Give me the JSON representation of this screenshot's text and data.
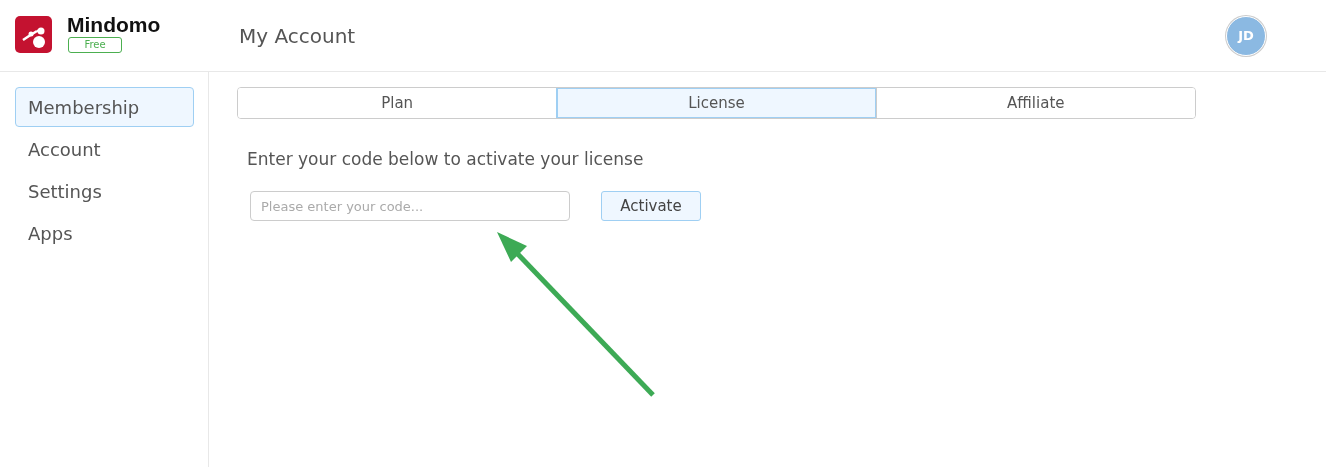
{
  "app": {
    "name": "Mindomo",
    "plan_badge": "Free"
  },
  "header": {
    "title": "My Account",
    "avatar_initials": "JD"
  },
  "sidebar": {
    "items": [
      {
        "label": "Membership",
        "selected": true
      },
      {
        "label": "Account",
        "selected": false
      },
      {
        "label": "Settings",
        "selected": false
      },
      {
        "label": "Apps",
        "selected": false
      }
    ]
  },
  "tabs": [
    {
      "label": "Plan",
      "selected": false
    },
    {
      "label": "License",
      "selected": true
    },
    {
      "label": "Affiliate",
      "selected": false
    }
  ],
  "license": {
    "instruction": "Enter your code below to activate your license",
    "code_field": {
      "placeholder": "Please enter your code..."
    },
    "button": "Activate"
  }
}
